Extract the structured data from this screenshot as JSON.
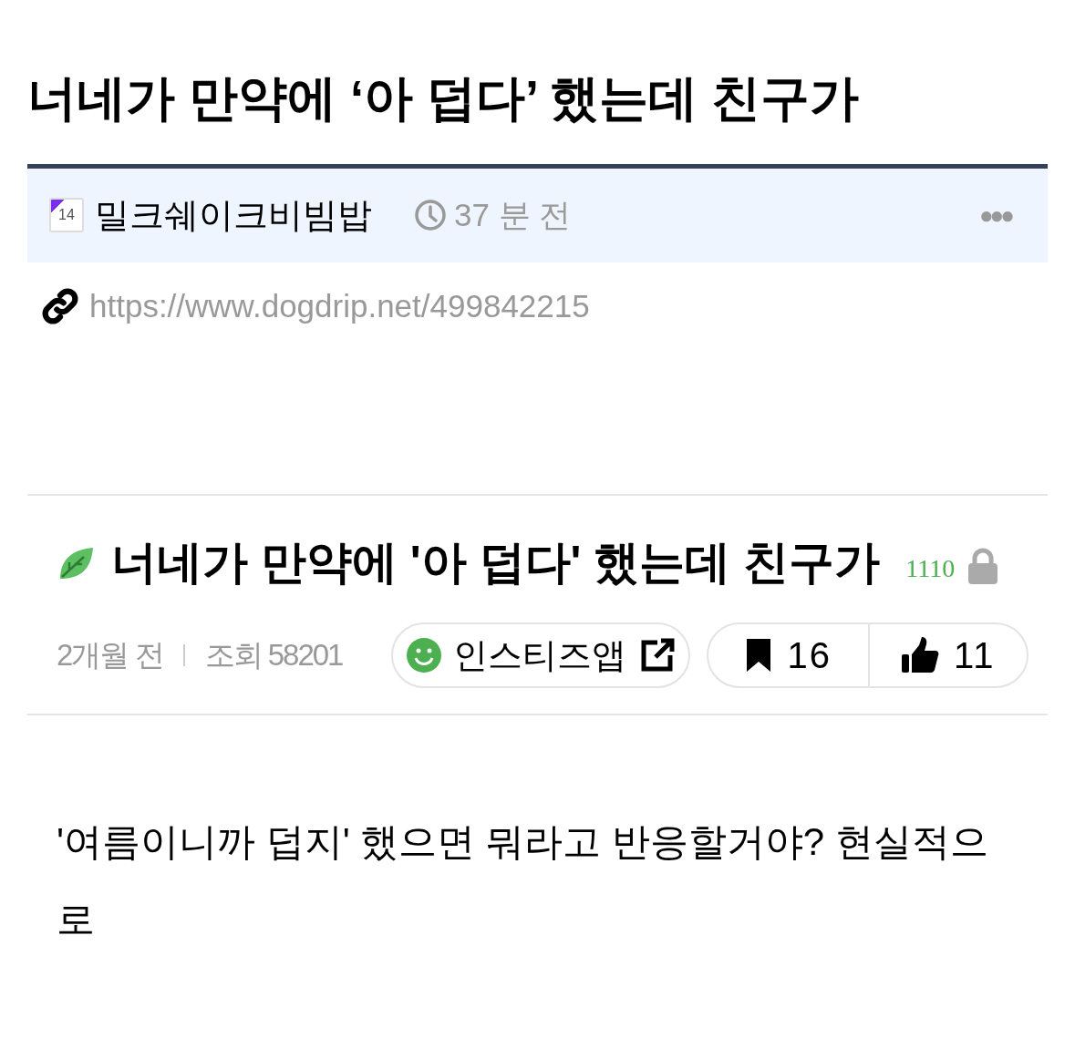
{
  "post_title": "너네가 만약에 ‘아 덥다’ 했는데 친구가",
  "author": {
    "badge": "14",
    "name": "밀크쉐이크비빔밥",
    "time": "37 분 전"
  },
  "menu": "●●●",
  "url": "https://www.dogdrip.net/499842215",
  "source": {
    "title": "너네가 만약에 '아 덥다' 했는데 친구가",
    "count": "1110",
    "locked": true,
    "age": "2개월 전",
    "views": "조회 58201",
    "app": "인스티즈앱",
    "bookmarks": "16",
    "likes": "11"
  },
  "body": "'여름이니까 덥지' 했으면 뭐라고 반응할거야? 현실적으로"
}
